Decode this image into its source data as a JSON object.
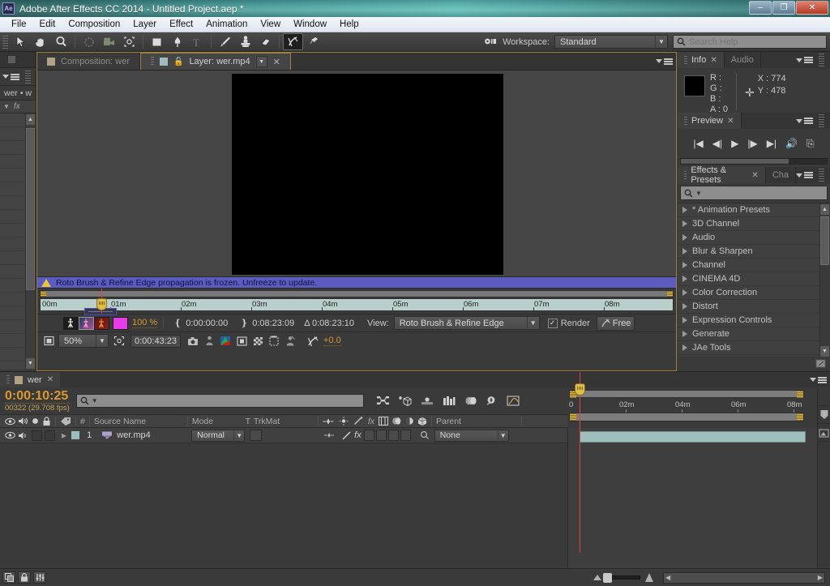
{
  "window": {
    "title": "Adobe After Effects CC 2014 - Untitled Project.aep *",
    "logo": "Ae",
    "minimize": "–",
    "maximize": "❐",
    "close": "✕"
  },
  "menu": [
    "File",
    "Edit",
    "Composition",
    "Layer",
    "Effect",
    "Animation",
    "View",
    "Window",
    "Help"
  ],
  "toolbar": {
    "workspace_label": "Workspace:",
    "workspace_value": "Standard",
    "search_help_placeholder": "Search Help",
    "tools": [
      {
        "name": "selection-tool",
        "glyph": "➤"
      },
      {
        "name": "hand-tool",
        "glyph": "✋"
      },
      {
        "name": "zoom-tool",
        "glyph": "🔍"
      },
      {
        "name": "rotation-tool",
        "glyph": "⟳"
      },
      {
        "name": "camera-tool",
        "glyph": "🎥"
      },
      {
        "name": "pan-behind-tool",
        "glyph": "✥"
      },
      {
        "name": "shape-tool",
        "glyph": "▭"
      },
      {
        "name": "pen-tool",
        "glyph": "✒"
      },
      {
        "name": "text-tool",
        "glyph": "T"
      },
      {
        "name": "brush-tool",
        "glyph": "🖌"
      },
      {
        "name": "clone-stamp-tool",
        "glyph": "⚱"
      },
      {
        "name": "eraser-tool",
        "glyph": "▰"
      },
      {
        "name": "roto-brush-tool",
        "glyph": "✎"
      },
      {
        "name": "puppet-pin-tool",
        "glyph": "📌"
      }
    ]
  },
  "left_panel": {
    "name": "wer • w",
    "fx_header": "fx"
  },
  "viewer": {
    "tabs": [
      {
        "label": "Composition: wer",
        "active": false
      },
      {
        "label": "Layer: wer.mp4",
        "active": true
      }
    ],
    "warning": "Roto Brush & Refine Edge propagation is frozen. Unfreeze to update.",
    "ruler_ticks": [
      "00m",
      "01m",
      "02m",
      "03m",
      "04m",
      "05m",
      "06m",
      "07m",
      "08m"
    ],
    "controls": {
      "resolution_value": "100 %",
      "in_point": "0:00:00:00",
      "out_point": "0:08:23:09",
      "duration_label": "Δ 0:08:23:10",
      "view_label": "View:",
      "view_value": "Roto Brush & Refine Edge",
      "render_label": "Render",
      "freeze_label": "Free",
      "magnification": "50%",
      "current_time": "0:00:43:23",
      "offset_value": "+0.0"
    }
  },
  "info_panel": {
    "tab": "Info",
    "tab2": "Audio",
    "r_label": "R :",
    "g_label": "G :",
    "b_label": "B :",
    "a_label": "A : 0",
    "x_label": "X : 774",
    "y_label": "Y : 478"
  },
  "preview_panel": {
    "tab": "Preview",
    "buttons": [
      {
        "name": "first-frame-button",
        "glyph": "|◀"
      },
      {
        "name": "previous-frame-button",
        "glyph": "◀|"
      },
      {
        "name": "play-button",
        "glyph": "▶"
      },
      {
        "name": "next-frame-button",
        "glyph": "|▶"
      },
      {
        "name": "last-frame-button",
        "glyph": "▶|"
      },
      {
        "name": "audio-button",
        "glyph": "🔊"
      },
      {
        "name": "ram-preview-button",
        "glyph": "⎘"
      }
    ]
  },
  "effects_panel": {
    "tab": "Effects & Presets",
    "tab2": "Cha",
    "categories": [
      "* Animation Presets",
      "3D Channel",
      "Audio",
      "Blur & Sharpen",
      "Channel",
      "CINEMA 4D",
      "Color Correction",
      "Distort",
      "Expression Controls",
      "Generate",
      "JAe Tools"
    ]
  },
  "timeline": {
    "tab": "wer",
    "current_time": "0:00:10:25",
    "frame_info": "00322 (29.708 fps)",
    "columns": [
      "Source Name",
      "Mode",
      "T",
      "TrkMat",
      "Parent"
    ],
    "ruler_ticks": [
      "0",
      "02m",
      "04m",
      "06m",
      "08m"
    ],
    "layers": [
      {
        "index": "1",
        "source_name": "wer.mp4",
        "mode": "Normal",
        "parent": "None"
      }
    ]
  },
  "colors": {
    "accent_orange": "#d89a2e",
    "panel_bg": "#3a3a3a",
    "warning_blue": "#5b5bc0",
    "layer_bar_teal": "#9ec0bd",
    "playhead_red": "#e04040"
  }
}
